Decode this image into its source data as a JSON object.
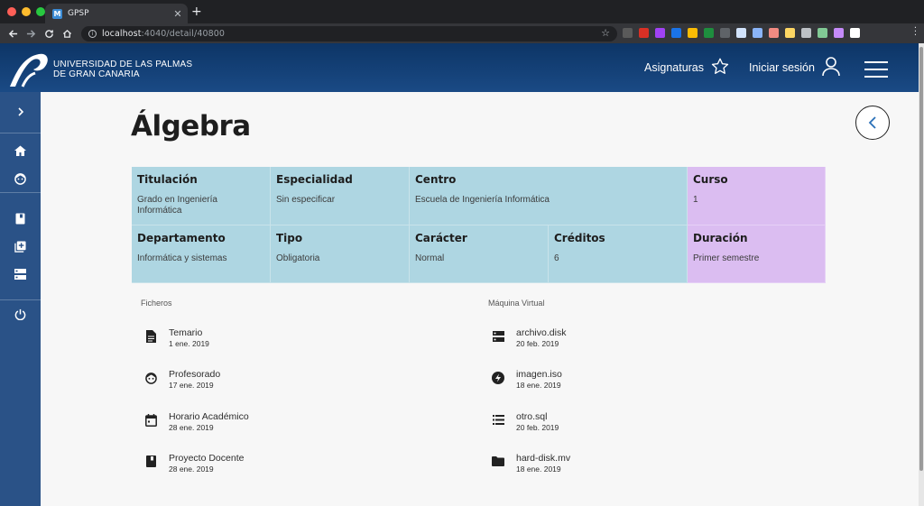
{
  "browser": {
    "tab_title": "GPSP",
    "tab_favicon": "M",
    "url_host": "localhost",
    "url_rest": ":4040/detail/40800",
    "ext_colors": [
      "#5a5a5a",
      "#d93025",
      "#a142f4",
      "#1a73e8",
      "#fbbc04",
      "#1e8e3e",
      "#5f6368",
      "#d2e3fc",
      "#8ab4f8",
      "#f28b82",
      "#fdd663",
      "#bdc1c6",
      "#81c995",
      "#c58af9",
      "#ffffff"
    ]
  },
  "header": {
    "logo_line1": "UNIVERSIDAD DE LAS PALMAS",
    "logo_line2": "DE GRAN CANARIA",
    "subjects_label": "Asignaturas",
    "login_label": "Iniciar sesión"
  },
  "page": {
    "title": "Álgebra"
  },
  "details": {
    "titulacion": {
      "label": "Titulación",
      "value": "Grado en Ingeniería Informática"
    },
    "especialidad": {
      "label": "Especialidad",
      "value": "Sin especificar"
    },
    "centro": {
      "label": "Centro",
      "value": "Escuela de Ingeniería Informática"
    },
    "curso": {
      "label": "Curso",
      "value": "1"
    },
    "departamento": {
      "label": "Departamento",
      "value": "Informática y sistemas"
    },
    "tipo": {
      "label": "Tipo",
      "value": "Obligatoria"
    },
    "caracter": {
      "label": "Carácter",
      "value": "Normal"
    },
    "creditos": {
      "label": "Créditos",
      "value": "6"
    },
    "duracion": {
      "label": "Duración",
      "value": "Primer semestre"
    }
  },
  "files": {
    "label": "Ficheros",
    "items": [
      {
        "icon": "document-icon",
        "name": "Temario",
        "date": "1 ene. 2019"
      },
      {
        "icon": "face-icon",
        "name": "Profesorado",
        "date": "17 ene. 2019"
      },
      {
        "icon": "calendar-icon",
        "name": "Horario Académico",
        "date": "28 ene. 2019"
      },
      {
        "icon": "book-icon",
        "name": "Proyecto Docente",
        "date": "28 ene. 2019"
      }
    ]
  },
  "vm": {
    "label": "Máquina Virtual",
    "items": [
      {
        "icon": "storage-icon",
        "name": "archivo.disk",
        "date": "20 feb. 2019"
      },
      {
        "icon": "bolt-icon",
        "name": "imagen.iso",
        "date": "18 ene. 2019"
      },
      {
        "icon": "list-icon",
        "name": "otro.sql",
        "date": "20 feb. 2019"
      },
      {
        "icon": "folder-icon",
        "name": "hard-disk.mv",
        "date": "18 ene. 2019"
      }
    ]
  }
}
